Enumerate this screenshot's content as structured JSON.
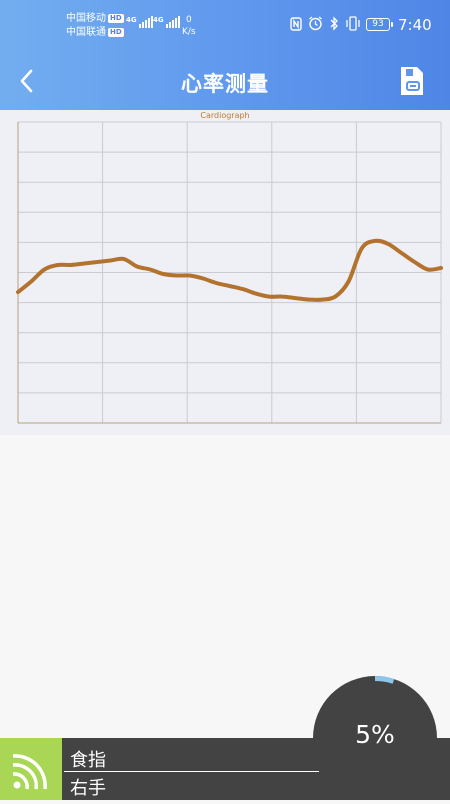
{
  "status_bar": {
    "carrier1": "中国移动",
    "carrier2": "中国联通",
    "hd": "HD",
    "net1": "4G",
    "net2": "4G",
    "speed_value": "0",
    "speed_unit": "K/s",
    "battery": "93",
    "time": "7:40"
  },
  "header": {
    "title": "心率测量",
    "back_icon": "chevron-left-icon",
    "save_icon": "save-record-icon"
  },
  "chart_data": {
    "type": "line",
    "title": "Cardiograph",
    "xlabel": "",
    "ylabel": "",
    "grid": true,
    "vertical_grid_lines": 5,
    "horizontal_grid_lines": 11,
    "series": [
      {
        "color": "#b3732e",
        "values": [
          0.565,
          0.53,
          0.49,
          0.475,
          0.475,
          0.47,
          0.465,
          0.46,
          0.455,
          0.48,
          0.49,
          0.505,
          0.51,
          0.51,
          0.52,
          0.535,
          0.545,
          0.555,
          0.57,
          0.58,
          0.58,
          0.585,
          0.59,
          0.59,
          0.58,
          0.53,
          0.42,
          0.395,
          0.405,
          0.435,
          0.465,
          0.49,
          0.485
        ]
      }
    ]
  },
  "measurement": {
    "finger": "食指",
    "hand": "右手",
    "progress": 0.05,
    "progress_label": "5%"
  },
  "colors": {
    "accent": "#5f97ee",
    "curve": "#b3732e",
    "finger_icon_bg": "#a9d654",
    "bottom_bar": "#434343",
    "progress_ring": "#8dc6ea"
  }
}
